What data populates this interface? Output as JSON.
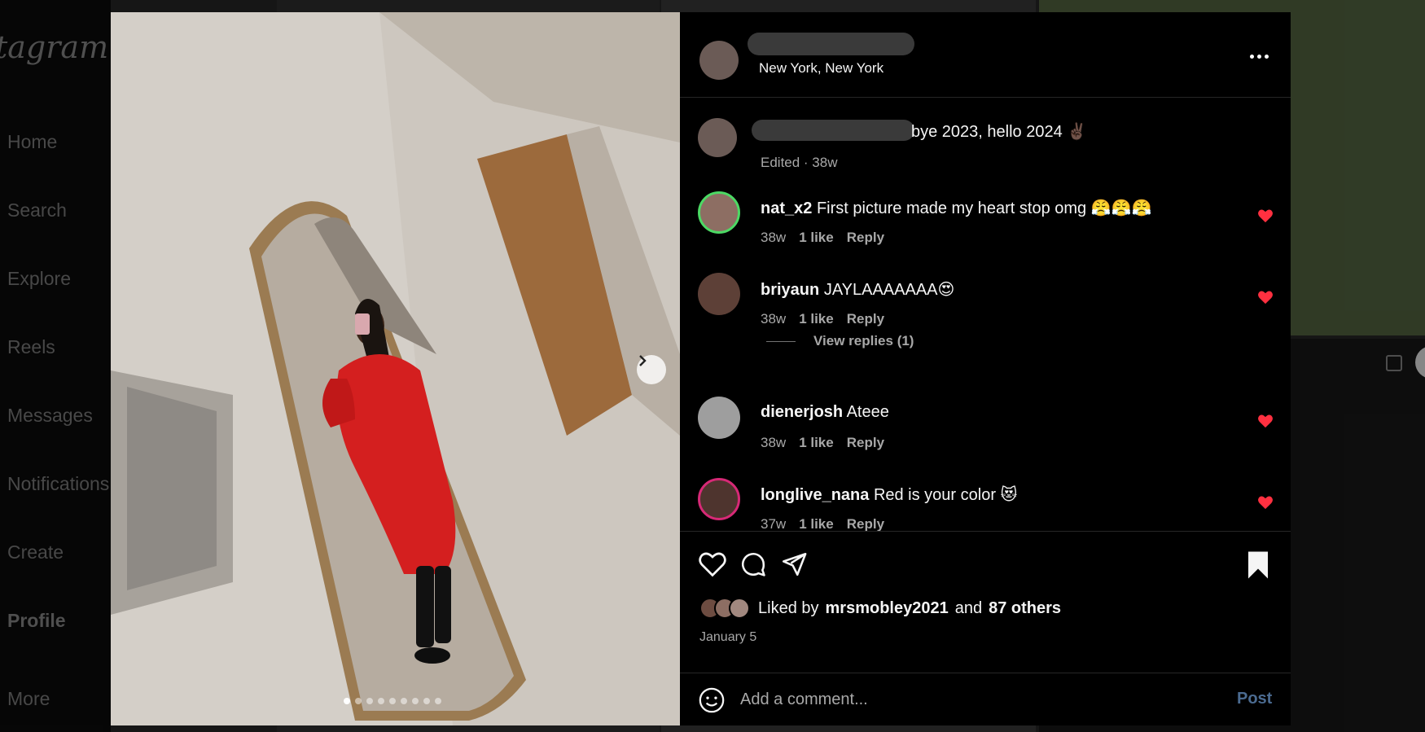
{
  "app": {
    "logo_text": "tagram"
  },
  "sidebar": {
    "items": [
      {
        "label": "Home"
      },
      {
        "label": "Search"
      },
      {
        "label": "Explore"
      },
      {
        "label": "Reels"
      },
      {
        "label": "Messages"
      },
      {
        "label": "Notifications"
      },
      {
        "label": "Create"
      },
      {
        "label": "Profile"
      },
      {
        "label": "More"
      }
    ]
  },
  "post": {
    "location": "New York, New York",
    "caption_text": "bye 2023, hello 2024 ✌🏿",
    "caption_meta": "Edited · 38w",
    "carousel": {
      "count": 9,
      "active_index": 0
    },
    "comments": [
      {
        "user": "nat_x2",
        "text": "First picture made my heart stop omg 😤😤😤",
        "age": "38w",
        "likes": "1 like",
        "reply": "Reply"
      },
      {
        "user": "briyaun",
        "text": "JAYLAAAAAAA😍",
        "age": "38w",
        "likes": "1 like",
        "reply": "Reply"
      },
      {
        "user": "dienerjosh",
        "text": "Ateee",
        "age": "38w",
        "likes": "1 like",
        "reply": "Reply"
      },
      {
        "user": "longlive_nana",
        "text": "Red is your color 😻",
        "age": "37w",
        "likes": "1 like",
        "reply": "Reply"
      }
    ],
    "view_replies": "View replies (1)",
    "liked_by_prefix": "Liked by",
    "liked_by_user": "mrsmobley2021",
    "liked_by_and": "and",
    "liked_by_others": "87 others",
    "date": "January 5",
    "comment_placeholder": "Add a comment...",
    "post_button": "Post"
  },
  "colors": {
    "like_red": "#ff3040",
    "post_blue": "#4b6b91",
    "dress_red": "#d41f1f"
  }
}
